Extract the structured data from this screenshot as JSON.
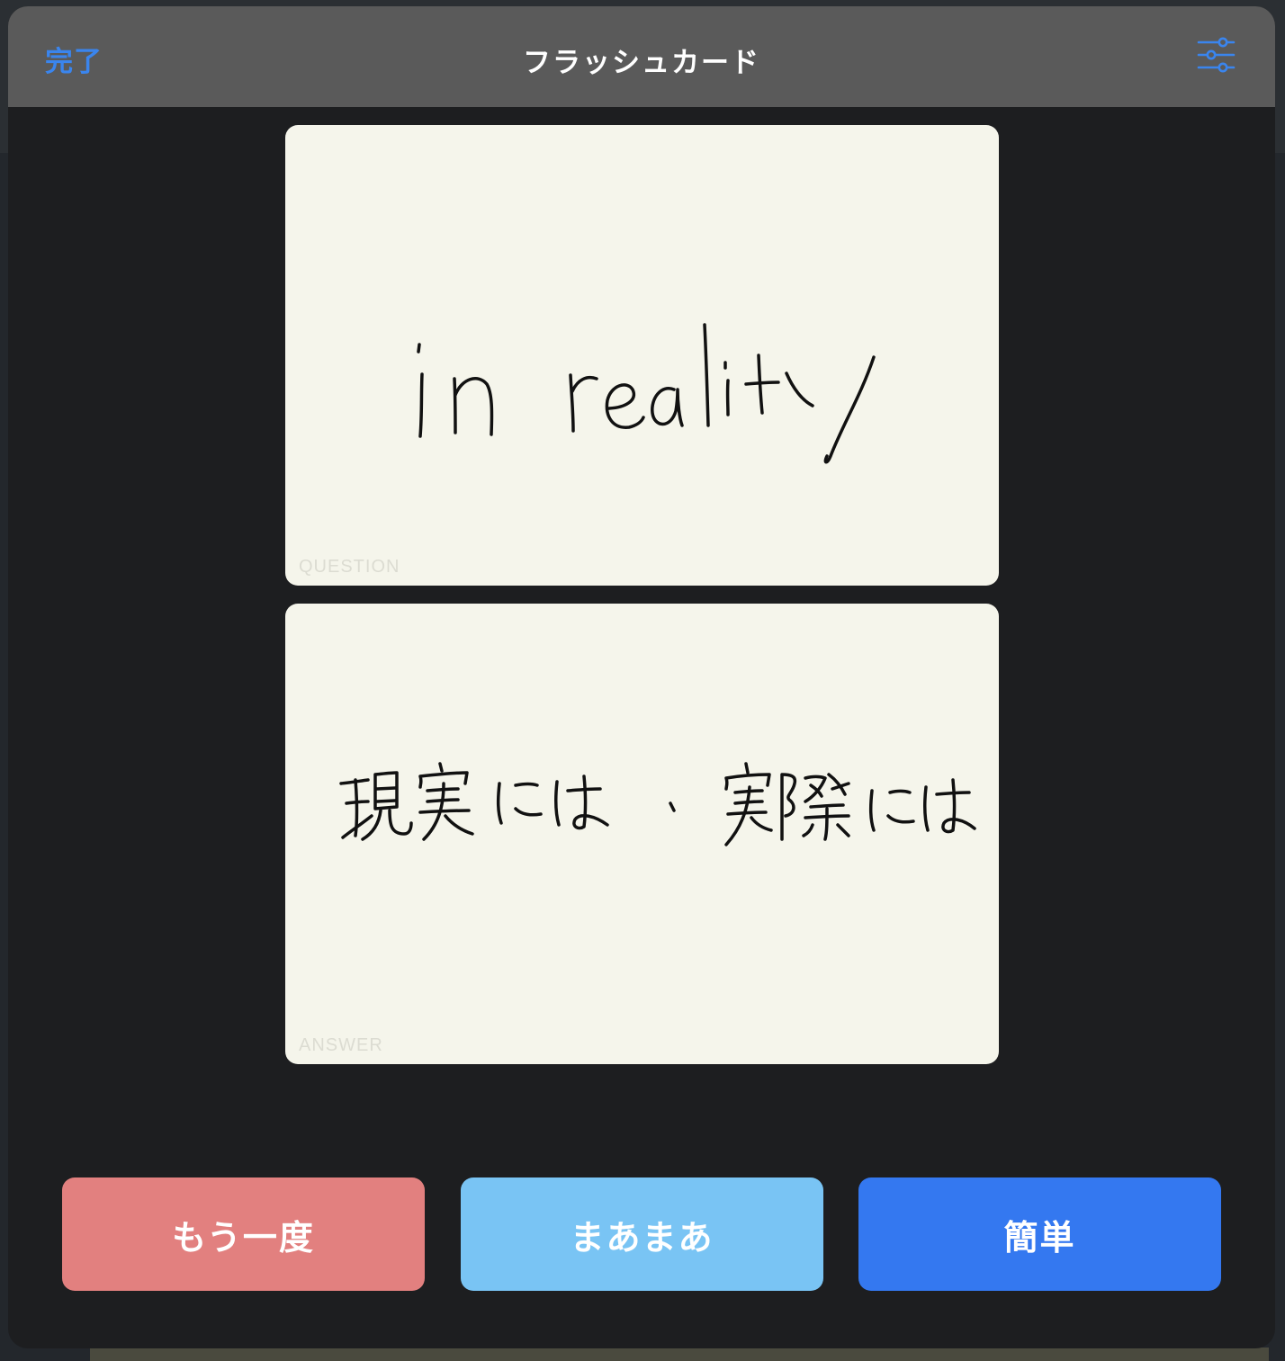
{
  "navbar": {
    "done_label": "完了",
    "title": "フラッシュカード",
    "settings_icon": "sliders-icon"
  },
  "cards": {
    "question": {
      "label": "QUESTION",
      "handwritten_text": "in reality"
    },
    "answer": {
      "label": "ANSWER",
      "handwritten_text": "現実には、実際には"
    }
  },
  "grade_buttons": {
    "again": "もう一度",
    "okay": "まあまあ",
    "easy": "簡単"
  },
  "colors": {
    "accent": "#3a85ee",
    "card_bg": "#f5f5eb",
    "again": "#e2807f",
    "okay": "#79c4f4",
    "easy": "#3478f0"
  }
}
